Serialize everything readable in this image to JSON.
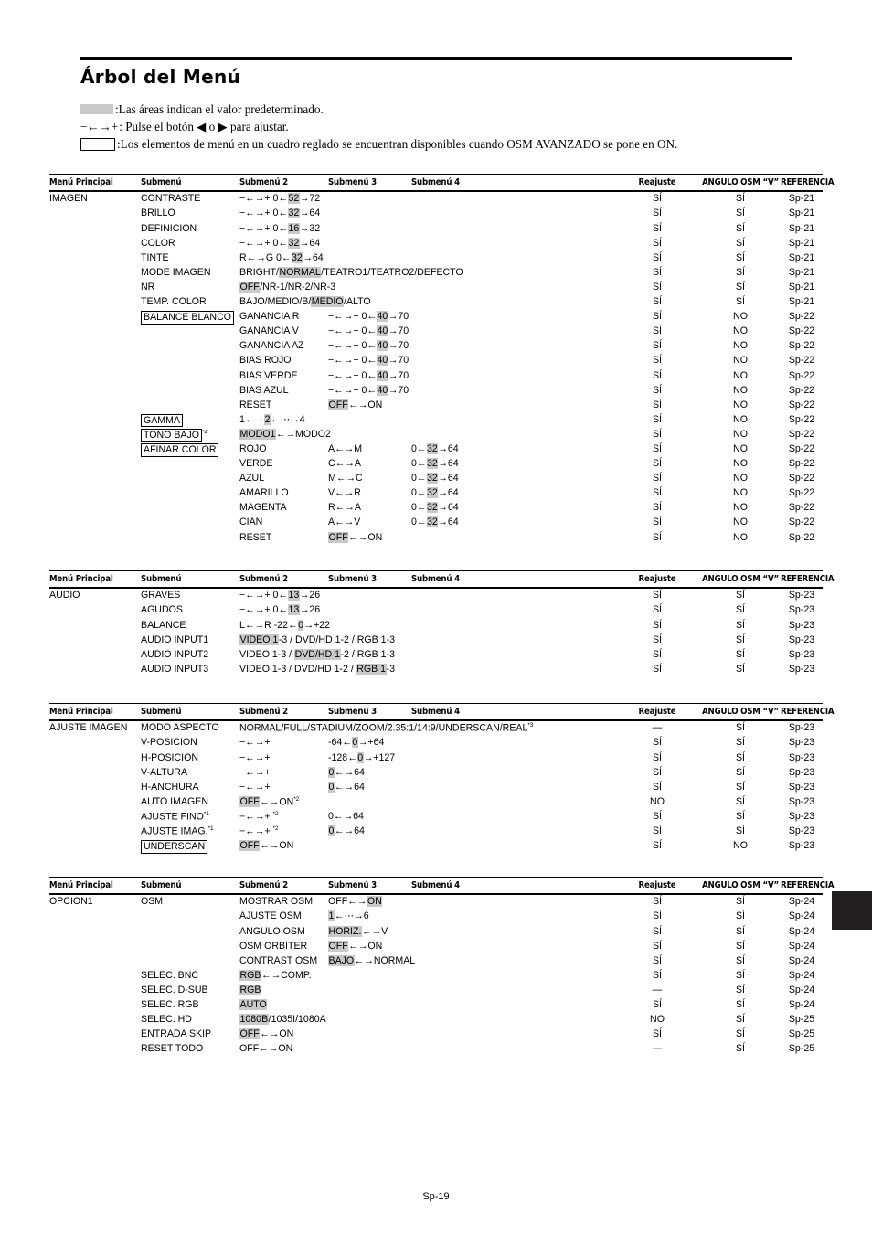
{
  "title": "Árbol del Menú",
  "legend": [
    {
      "marker": "swatch",
      "text": ":Las áreas indican el valor predeterminado."
    },
    {
      "marker": "arrows",
      "arrow_label": "−←→+",
      "text": ": Pulse el botón ◀ o ▶ para ajustar."
    },
    {
      "marker": "box",
      "text": ":Los elementos de menú en un cuadro reglado se encuentran disponibles cuando OSM AVANZADO se pone en ON."
    }
  ],
  "columns": {
    "main": "Menú Principal",
    "sub1": "Submenú",
    "sub2": "Submenú 2",
    "sub3": "Submenú 3",
    "sub4": "Submenú 4",
    "reajuste": "Reajuste",
    "angulo": "ANGULO OSM “V”",
    "referencia": "REFERENCIA"
  },
  "footer": "Sp-19",
  "colors": {
    "highlight": "#c9c9c9",
    "rule": "#000000",
    "index_tab": "#231f20"
  },
  "tables": [
    {
      "id": "imagen",
      "rows": [
        {
          "main": "IMAGEN",
          "sub1": "CONTRASTE",
          "sub2": "−←→+  0←|52|→72",
          "sub3": "",
          "sub4": "",
          "re": "SÍ",
          "ang": "SÍ",
          "ref": "Sp-21"
        },
        {
          "main": "",
          "sub1": "BRILLO",
          "sub2": "−←→+  0←|32|→64",
          "sub3": "",
          "sub4": "",
          "re": "SÍ",
          "ang": "SÍ",
          "ref": "Sp-21"
        },
        {
          "main": "",
          "sub1": "DEFINICION",
          "sub2": "−←→+  0←|16|→32",
          "sub3": "",
          "sub4": "",
          "re": "SÍ",
          "ang": "SÍ",
          "ref": "Sp-21"
        },
        {
          "main": "",
          "sub1": "COLOR",
          "sub2": "−←→+  0←|32|→64",
          "sub3": "",
          "sub4": "",
          "re": "SÍ",
          "ang": "SÍ",
          "ref": "Sp-21"
        },
        {
          "main": "",
          "sub1": "TINTE",
          "sub2": "R←→G  0←|32|→64",
          "sub3": "",
          "sub4": "",
          "re": "SÍ",
          "ang": "SÍ",
          "ref": "Sp-21"
        },
        {
          "main": "",
          "sub1": "MODE IMAGEN",
          "sub2": "BRIGHT/|NORMAL|/TEATRO1/TEATRO2/DEFECTO",
          "sub3": "",
          "sub4": "",
          "re": "SÍ",
          "ang": "SÍ",
          "ref": "Sp-21"
        },
        {
          "main": "",
          "sub1": "NR",
          "sub2": "|OFF|/NR-1/NR-2/NR-3",
          "sub3": "",
          "sub4": "",
          "re": "SÍ",
          "ang": "SÍ",
          "ref": "Sp-21"
        },
        {
          "main": "",
          "sub1": "TEMP. COLOR",
          "sub2": "BAJO/MEDIO/B/|MEDIO|/ALTO",
          "sub3": "",
          "sub4": "",
          "re": "SÍ",
          "ang": "SÍ",
          "ref": "Sp-21"
        },
        {
          "main": "",
          "sub1": "[BALANCE BLANCO]",
          "sub2": "GANANCIA R",
          "sub3": "−←→+  0←|40|→70",
          "sub4": "",
          "re": "SÍ",
          "ang": "NO",
          "ref": "Sp-22"
        },
        {
          "main": "",
          "sub1": "",
          "sub2": "GANANCIA V",
          "sub3": "−←→+  0←|40|→70",
          "sub4": "",
          "re": "SÍ",
          "ang": "NO",
          "ref": "Sp-22"
        },
        {
          "main": "",
          "sub1": "",
          "sub2": "GANANCIA AZ",
          "sub3": "−←→+  0←|40|→70",
          "sub4": "",
          "re": "SÍ",
          "ang": "NO",
          "ref": "Sp-22"
        },
        {
          "main": "",
          "sub1": "",
          "sub2": "BIAS ROJO",
          "sub3": "−←→+  0←|40|→70",
          "sub4": "",
          "re": "SÍ",
          "ang": "NO",
          "ref": "Sp-22"
        },
        {
          "main": "",
          "sub1": "",
          "sub2": "BIAS VERDE",
          "sub3": "−←→+  0←|40|→70",
          "sub4": "",
          "re": "SÍ",
          "ang": "NO",
          "ref": "Sp-22"
        },
        {
          "main": "",
          "sub1": "",
          "sub2": "BIAS AZUL",
          "sub3": "−←→+  0←|40|→70",
          "sub4": "",
          "re": "SÍ",
          "ang": "NO",
          "ref": "Sp-22"
        },
        {
          "main": "",
          "sub1": "",
          "sub2": "RESET",
          "sub3": "|OFF|←→ON",
          "sub4": "",
          "re": "SÍ",
          "ang": "NO",
          "ref": "Sp-22"
        },
        {
          "main": "",
          "sub1": "[GAMMA]",
          "sub2": "1←→|2|←⋯→4",
          "sub3": "",
          "sub4": "",
          "re": "SÍ",
          "ang": "NO",
          "ref": "Sp-22"
        },
        {
          "main": "",
          "sub1": "[TONO BAJO]^*4",
          "sub2": "|MODO1|←→MODO2",
          "sub3": "",
          "sub4": "",
          "re": "SÍ",
          "ang": "NO",
          "ref": "Sp-22"
        },
        {
          "main": "",
          "sub1": "[AFINAR COLOR]",
          "sub2": "ROJO",
          "sub3": "A←→M",
          "sub4": "0←|32|→64",
          "re": "SÍ",
          "ang": "NO",
          "ref": "Sp-22"
        },
        {
          "main": "",
          "sub1": "",
          "sub2": "VERDE",
          "sub3": "C←→A",
          "sub4": "0←|32|→64",
          "re": "SÍ",
          "ang": "NO",
          "ref": "Sp-22"
        },
        {
          "main": "",
          "sub1": "",
          "sub2": "AZUL",
          "sub3": "M←→C",
          "sub4": "0←|32|→64",
          "re": "SÍ",
          "ang": "NO",
          "ref": "Sp-22"
        },
        {
          "main": "",
          "sub1": "",
          "sub2": "AMARILLO",
          "sub3": "V←→R",
          "sub4": "0←|32|→64",
          "re": "SÍ",
          "ang": "NO",
          "ref": "Sp-22"
        },
        {
          "main": "",
          "sub1": "",
          "sub2": "MAGENTA",
          "sub3": "R←→A",
          "sub4": "0←|32|→64",
          "re": "SÍ",
          "ang": "NO",
          "ref": "Sp-22"
        },
        {
          "main": "",
          "sub1": "",
          "sub2": "CIAN",
          "sub3": "A←→V",
          "sub4": "0←|32|→64",
          "re": "SÍ",
          "ang": "NO",
          "ref": "Sp-22"
        },
        {
          "main": "",
          "sub1": "",
          "sub2": "RESET",
          "sub3": "|OFF|←→ON",
          "sub4": "",
          "re": "SÍ",
          "ang": "NO",
          "ref": "Sp-22"
        }
      ]
    },
    {
      "id": "audio",
      "rows": [
        {
          "main": "AUDIO",
          "sub1": "GRAVES",
          "sub2": "−←→+  0←|13|→26",
          "sub3": "",
          "sub4": "",
          "re": "SÍ",
          "ang": "SÍ",
          "ref": "Sp-23"
        },
        {
          "main": "",
          "sub1": "AGUDOS",
          "sub2": "−←→+  0←|13|→26",
          "sub3": "",
          "sub4": "",
          "re": "SÍ",
          "ang": "SÍ",
          "ref": "Sp-23"
        },
        {
          "main": "",
          "sub1": "BALANCE",
          "sub2": "L←→R    -22←|0|→+22",
          "sub3": "",
          "sub4": "",
          "re": "SÍ",
          "ang": "SÍ",
          "ref": "Sp-23"
        },
        {
          "main": "",
          "sub1": "AUDIO INPUT1",
          "sub2": "|VIDEO 1|-3 / DVD/HD 1-2 / RGB 1-3",
          "sub3": "",
          "sub4": "",
          "re": "SÍ",
          "ang": "SÍ",
          "ref": "Sp-23"
        },
        {
          "main": "",
          "sub1": "AUDIO INPUT2",
          "sub2": "VIDEO 1-3 / |DVD/HD 1|-2 / RGB 1-3",
          "sub3": "",
          "sub4": "",
          "re": "SÍ",
          "ang": "SÍ",
          "ref": "Sp-23"
        },
        {
          "main": "",
          "sub1": "AUDIO INPUT3",
          "sub2": "VIDEO 1-3 / DVD/HD 1-2 / |RGB 1|-3",
          "sub3": "",
          "sub4": "",
          "re": "SÍ",
          "ang": "SÍ",
          "ref": "Sp-23"
        }
      ]
    },
    {
      "id": "ajuste-imagen",
      "rows": [
        {
          "main": "AJUSTE IMAGEN",
          "sub1": "MODO ASPECTO",
          "sub2": "NORMAL/FULL/STADIUM/ZOOM/2.35:1/14:9/UNDERSCAN/REAL^*3",
          "sub3": "",
          "sub4": "",
          "re": "—",
          "ang": "SÍ",
          "ref": "Sp-23"
        },
        {
          "main": "",
          "sub1": "V-POSICION",
          "sub2": "−←→+",
          "sub3": "-64←|0|→+64",
          "sub4": "",
          "re": "SÍ",
          "ang": "SÍ",
          "ref": "Sp-23"
        },
        {
          "main": "",
          "sub1": "H-POSICION",
          "sub2": "−←→+",
          "sub3": "-128←|0|→+127",
          "sub4": "",
          "re": "SÍ",
          "ang": "SÍ",
          "ref": "Sp-23"
        },
        {
          "main": "",
          "sub1": "V-ALTURA",
          "sub2": "−←→+",
          "sub3": "|0|←→64",
          "sub4": "",
          "re": "SÍ",
          "ang": "SÍ",
          "ref": "Sp-23"
        },
        {
          "main": "",
          "sub1": "H-ANCHURA",
          "sub2": "−←→+",
          "sub3": "|0|←→64",
          "sub4": "",
          "re": "SÍ",
          "ang": "SÍ",
          "ref": "Sp-23"
        },
        {
          "main": "",
          "sub1": "AUTO IMAGEN",
          "sub2": "|OFF|←→ON^*2",
          "sub3": "",
          "sub4": "",
          "re": "NO",
          "ang": "SÍ",
          "ref": "Sp-23"
        },
        {
          "main": "",
          "sub1": "AJUSTE FINO^*1",
          "sub2": "−←→+ ^*2",
          "sub3": "0←→64",
          "sub4": "",
          "re": "SÍ",
          "ang": "SÍ",
          "ref": "Sp-23"
        },
        {
          "main": "",
          "sub1": "AJUSTE IMAG.^*1",
          "sub2": "−←→+ ^*2",
          "sub3": "|0|←→64",
          "sub4": "",
          "re": "SÍ",
          "ang": "SÍ",
          "ref": "Sp-23"
        },
        {
          "main": "",
          "sub1": "[UNDERSCAN]",
          "sub2": "|OFF|←→ON",
          "sub3": "",
          "sub4": "",
          "re": "SÍ",
          "ang": "NO",
          "ref": "Sp-23"
        }
      ]
    },
    {
      "id": "opcion1",
      "rows": [
        {
          "main": "OPCION1",
          "sub1": "OSM",
          "sub2": "MOSTRAR OSM",
          "sub3": "OFF←→|ON|",
          "sub4": "",
          "re": "SÍ",
          "ang": "SÍ",
          "ref": "Sp-24"
        },
        {
          "main": "",
          "sub1": "",
          "sub2": "AJUSTE OSM",
          "sub3": "|1|←⋯→6",
          "sub4": "",
          "re": "SÍ",
          "ang": "SÍ",
          "ref": "Sp-24"
        },
        {
          "main": "",
          "sub1": "",
          "sub2": "ANGULO OSM",
          "sub3": "|HORIZ.|←→V",
          "sub4": "",
          "re": "SÍ",
          "ang": "SÍ",
          "ref": "Sp-24"
        },
        {
          "main": "",
          "sub1": "",
          "sub2": "OSM ORBITER",
          "sub3": "|OFF|←→ON",
          "sub4": "",
          "re": "SÍ",
          "ang": "SÍ",
          "ref": "Sp-24"
        },
        {
          "main": "",
          "sub1": "",
          "sub2": "CONTRAST OSM",
          "sub3": "|BAJO|←→NORMAL",
          "sub4": "",
          "re": "SÍ",
          "ang": "SÍ",
          "ref": "Sp-24"
        },
        {
          "main": "",
          "sub1": "SELEC. BNC",
          "sub2": "|RGB|←→COMP.",
          "sub3": "",
          "sub4": "",
          "re": "SÍ",
          "ang": "SÍ",
          "ref": "Sp-24"
        },
        {
          "main": "",
          "sub1": "SELEC. D-SUB",
          "sub2": "|RGB|",
          "sub3": "",
          "sub4": "",
          "re": "—",
          "ang": "SÍ",
          "ref": "Sp-24"
        },
        {
          "main": "",
          "sub1": "SELEC. RGB",
          "sub2": "|AUTO|",
          "sub3": "",
          "sub4": "",
          "re": "SÍ",
          "ang": "SÍ",
          "ref": "Sp-24"
        },
        {
          "main": "",
          "sub1": "SELEC. HD",
          "sub2": "|1080B|/1035I/1080A",
          "sub3": "",
          "sub4": "",
          "re": "NO",
          "ang": "SÍ",
          "ref": "Sp-25"
        },
        {
          "main": "",
          "sub1": "ENTRADA SKIP",
          "sub2": "|OFF|←→ON",
          "sub3": "",
          "sub4": "",
          "re": "SÍ",
          "ang": "SÍ",
          "ref": "Sp-25"
        },
        {
          "main": "",
          "sub1": "RESET TODO",
          "sub2": "OFF←→ON",
          "sub3": "",
          "sub4": "",
          "re": "—",
          "ang": "SÍ",
          "ref": "Sp-25"
        }
      ]
    }
  ],
  "table_tops": [
    190,
    624,
    769,
    959
  ]
}
